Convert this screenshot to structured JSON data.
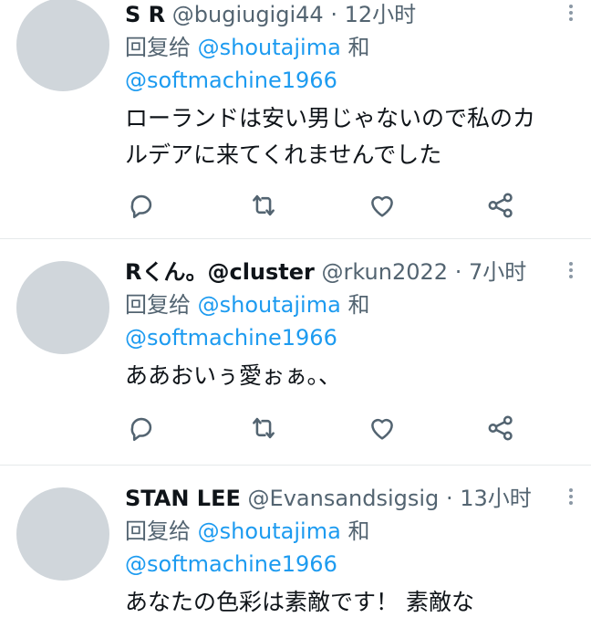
{
  "tweets": [
    {
      "name": "S R",
      "handle": "@bugiugigi44",
      "dot": "·",
      "time": "12小时",
      "reply_prefix": "回复给",
      "mention1": "@shoutajima",
      "conj": "和",
      "mention2": "@softmachine1966",
      "text_line1": "ローランドは安い男じゃないので私のカ",
      "text_line2": "ルデアに来てくれませんでした"
    },
    {
      "name": "Rくん。@cluster",
      "handle": "@rkun2022",
      "dot": "·",
      "time": "7小时",
      "reply_prefix": "回复给",
      "mention1": "@shoutajima",
      "conj": "和",
      "mention2": "@softmachine1966",
      "text_line1": "ああおいぅ愛ぉぁ。、"
    },
    {
      "name": "STAN LEE",
      "handle": "@Evansandsigsig",
      "dot": "·",
      "time": "13小时",
      "reply_prefix": "回复给",
      "mention1": "@shoutajima",
      "conj": "和",
      "mention2": "@softmachine1966",
      "text_line1": "あなたの色彩は素敵です！ 素敵な"
    }
  ],
  "icons": {
    "reply": "reply-icon",
    "retweet": "retweet-icon",
    "like": "heart-icon",
    "share": "share-icon",
    "more": "more-icon"
  },
  "colors": {
    "mention": "#1d9bf0",
    "secondary_text": "#536471",
    "avatar": "#d0d6db",
    "icon": "#536471"
  }
}
